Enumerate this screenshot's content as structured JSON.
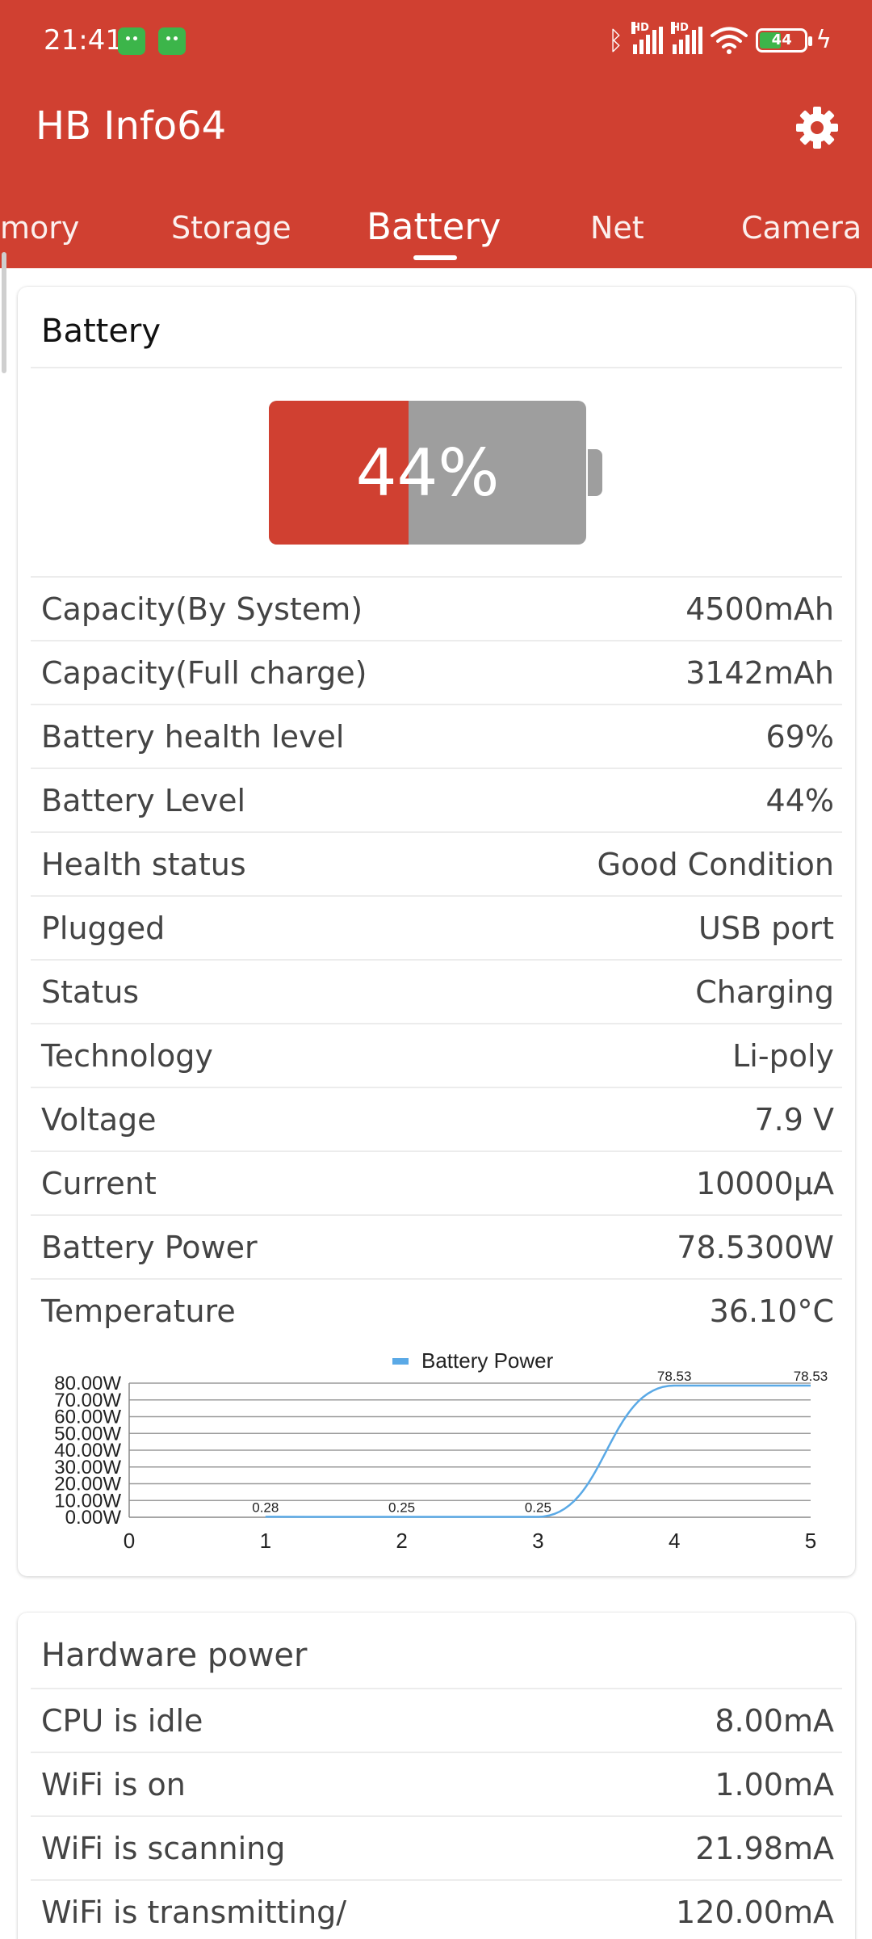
{
  "status_bar": {
    "time": "21:41",
    "battery_level": "44",
    "signal_1_label": "HD",
    "signal_2_label": "HD"
  },
  "app": {
    "title": "HB Info64"
  },
  "tabs": [
    {
      "label": "mory"
    },
    {
      "label": "Storage"
    },
    {
      "label": "Battery",
      "active": true
    },
    {
      "label": "Net"
    },
    {
      "label": "Camera"
    }
  ],
  "battery_card": {
    "title": "Battery",
    "level_text": "44%",
    "level_value": 44,
    "rows": [
      {
        "label": "Capacity(By System)",
        "value": "4500mAh"
      },
      {
        "label": "Capacity(Full charge)",
        "value": "3142mAh"
      },
      {
        "label": "Battery health level",
        "value": "69%"
      },
      {
        "label": "Battery Level",
        "value": "44%"
      },
      {
        "label": "Health status",
        "value": "Good Condition"
      },
      {
        "label": "Plugged",
        "value": "USB port"
      },
      {
        "label": "Status",
        "value": "Charging"
      },
      {
        "label": "Technology",
        "value": "Li-poly"
      },
      {
        "label": "Voltage",
        "value": "7.9 V"
      },
      {
        "label": "Current",
        "value": "10000μA"
      },
      {
        "label": "Battery Power",
        "value": "78.5300W"
      },
      {
        "label": "Temperature",
        "value": "36.10°C"
      }
    ]
  },
  "chart_data": {
    "type": "line",
    "legend": [
      "Battery Power"
    ],
    "legend_position": "top-center",
    "x_ticks": [
      "0",
      "1",
      "2",
      "3",
      "4",
      "5"
    ],
    "y_ticks": [
      "0.00W",
      "10.00W",
      "20.00W",
      "30.00W",
      "40.00W",
      "50.00W",
      "60.00W",
      "70.00W",
      "80.00W"
    ],
    "ylim": [
      0,
      80
    ],
    "xlim": [
      0,
      5
    ],
    "grid": true,
    "series": [
      {
        "name": "Battery Power",
        "color": "#5aa9e6",
        "x": [
          1,
          2,
          3,
          4,
          5
        ],
        "values": [
          0.28,
          0.25,
          0.25,
          78.53,
          78.53
        ],
        "labels": [
          "0.28",
          "0.25",
          "0.25",
          "78.53",
          "78.53"
        ]
      }
    ]
  },
  "hardware_card": {
    "title": "Hardware power",
    "rows": [
      {
        "label": "CPU is idle",
        "value": "8.00mA"
      },
      {
        "label": "WiFi is on",
        "value": "1.00mA"
      },
      {
        "label": "WiFi is scanning",
        "value": "21.98mA"
      },
      {
        "label": "WiFi is transmitting/",
        "value": "120.00mA"
      }
    ]
  },
  "colors": {
    "primary": "#d04031",
    "battery_empty": "#9e9e9e",
    "chart_line": "#5aa9e6",
    "notification_icon": "#3cb54a"
  }
}
